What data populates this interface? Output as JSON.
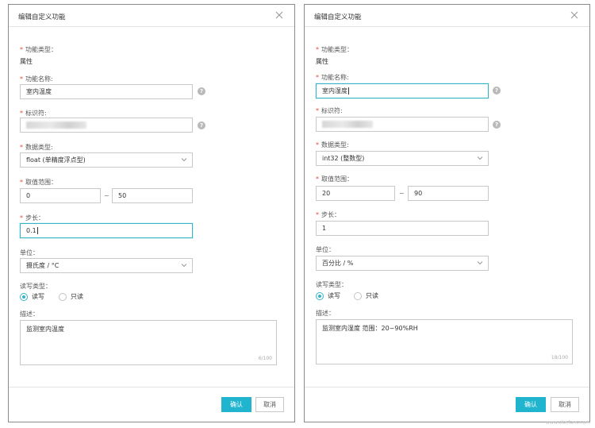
{
  "left": {
    "title": "编辑自定义功能",
    "function_type_label": "功能类型：",
    "function_type_value": "属性",
    "function_name_label": "功能名称:",
    "function_name_value": "室内温度",
    "identifier_label": "标识符:",
    "data_type_label": "数据类型:",
    "data_type_value": "float (单精度浮点型)",
    "range_label": "取值范围：",
    "range_min": "0",
    "range_sep": "~",
    "range_max": "50",
    "step_label": "步长：",
    "step_value": "0.1",
    "unit_label": "单位：",
    "unit_value": "摄氏度 / °C",
    "rw_label": "读写类型：",
    "rw_options": [
      "读写",
      "只读"
    ],
    "rw_selected": 0,
    "desc_label": "描述：",
    "desc_value": "监测室内温度",
    "desc_counter": "6/100",
    "confirm_label": "确认",
    "cancel_label": "取消"
  },
  "right": {
    "title": "编辑自定义功能",
    "function_type_label": "功能类型：",
    "function_type_value": "属性",
    "function_name_label": "功能名称:",
    "function_name_value": "室内湿度",
    "identifier_label": "标识符:",
    "data_type_label": "数据类型:",
    "data_type_value": "int32 (整数型)",
    "range_label": "取值范围：",
    "range_min": "20",
    "range_sep": "~",
    "range_max": "90",
    "step_label": "步长：",
    "step_value": "1",
    "unit_label": "单位：",
    "unit_value": "百分比 / %",
    "rw_label": "读写类型：",
    "rw_options": [
      "读写",
      "只读"
    ],
    "rw_selected": 0,
    "desc_label": "描述：",
    "desc_value": "监测室内湿度 范围：20~90%RH",
    "desc_counter": "18/100",
    "confirm_label": "确认",
    "cancel_label": "取消"
  },
  "icons": {
    "close": "close-icon",
    "help": "help-icon",
    "dropdown": "chevron-down-icon"
  },
  "colors": {
    "accent": "#21b4cf",
    "required": "#e34b3f",
    "focus_border": "#38b4c8"
  },
  "watermark": "www.elecfans.com"
}
